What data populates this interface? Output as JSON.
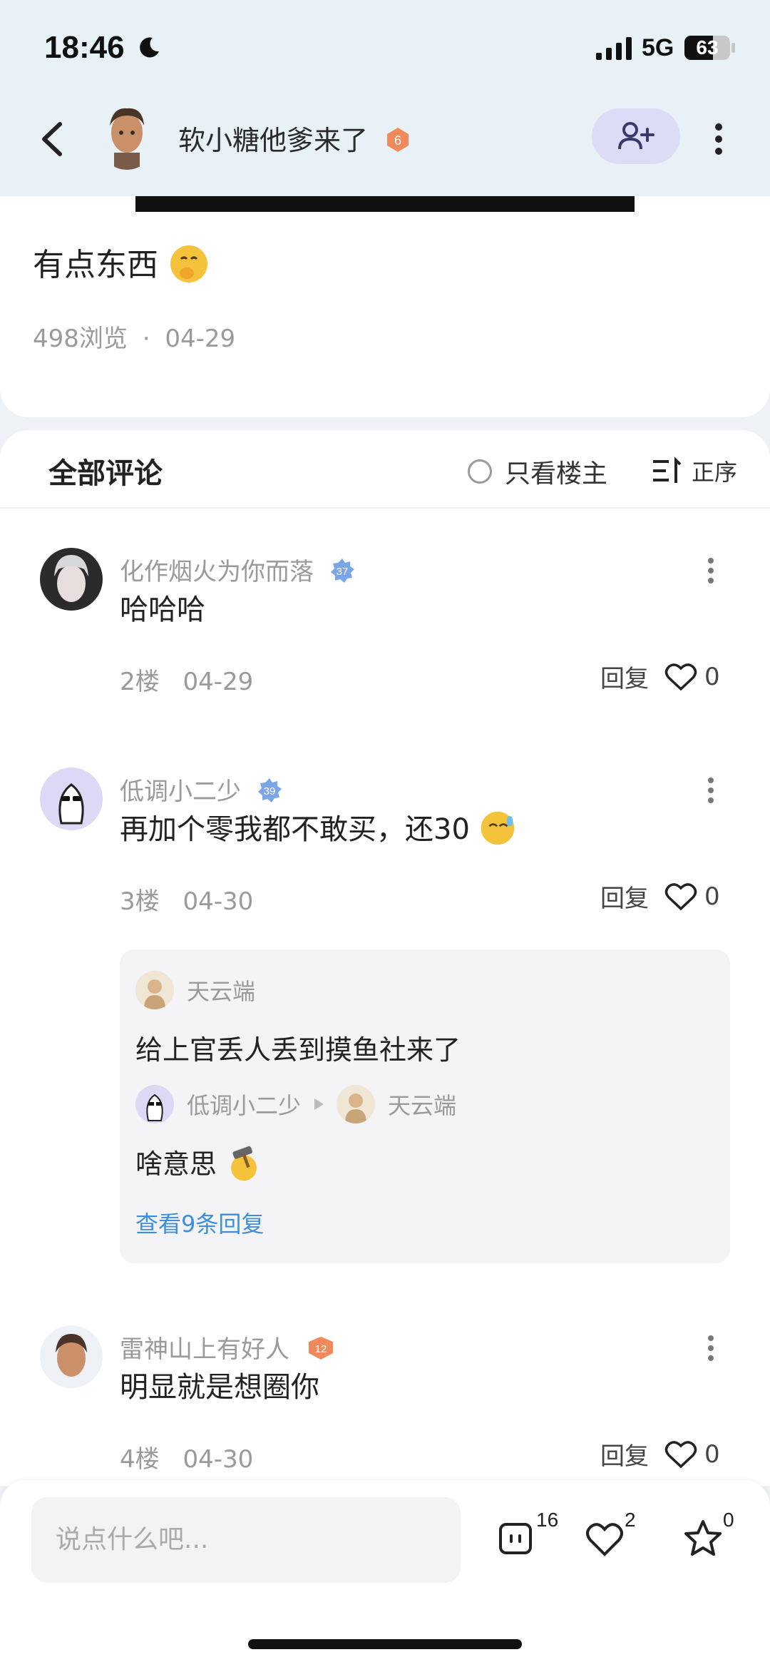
{
  "status_bar": {
    "time": "18:46",
    "network": "5G",
    "battery": "63",
    "battery_level": 0.63
  },
  "nav": {
    "author_name": "软小糖他爹来了",
    "author_level": "6",
    "follow_icon": "add-user-icon",
    "more_icon": "more-vertical-icon"
  },
  "post": {
    "text": "有点东西",
    "views": "498浏览",
    "separator": "·",
    "date": "04-29"
  },
  "comments_header": {
    "title": "全部评论",
    "only_op": "只看楼主",
    "sort": "正序"
  },
  "comments": [
    {
      "name": "化作烟火为你而落",
      "level": "37",
      "text": "哈哈哈",
      "floor": "2楼",
      "date": "04-29",
      "reply": "回复",
      "likes": "0"
    },
    {
      "name": "低调小二少",
      "level": "39",
      "text": "再加个零我都不敢买，还30",
      "floor": "3楼",
      "date": "04-30",
      "reply": "回复",
      "likes": "0"
    },
    {
      "name": "雷神山上有好人",
      "level": "12",
      "text": "明显就是想圈你",
      "floor": "4楼",
      "date": "04-30",
      "reply": "回复",
      "likes": "0"
    }
  ],
  "replies": {
    "first_name": "天云端",
    "first_text": "给上官丢人丢到摸鱼社来了",
    "second_from": "低调小二少",
    "second_to": "天云端",
    "second_text": "啥意思",
    "view_more": "查看9条回复"
  },
  "bottom_bar": {
    "placeholder": "说点什么吧...",
    "comment_count": "16",
    "like_count": "2",
    "fav_count": "0"
  },
  "colors": {
    "accent": "#3d8fdc",
    "header_bg": "#e8f1f6",
    "follow_bg": "#dcdcf7"
  }
}
